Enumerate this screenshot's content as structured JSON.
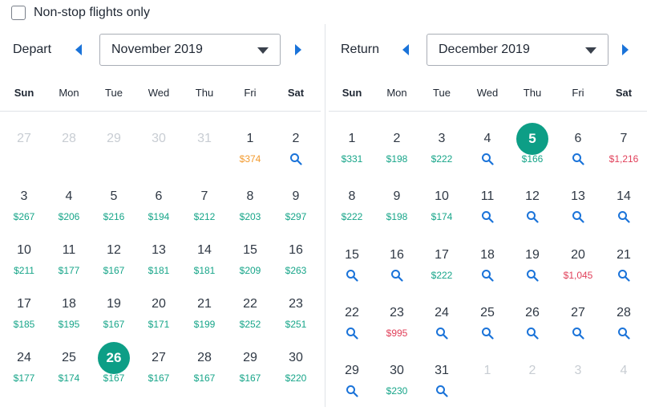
{
  "filters": {
    "nonstop_label": "Non-stop flights only",
    "nonstop_checked": false
  },
  "colors": {
    "accent": "#0d9e86",
    "price_low": "#17a589",
    "price_mid": "#f39b2f",
    "price_high": "#e1405a",
    "arrow": "#1a73d9"
  },
  "weekdays": [
    "Sun",
    "Mon",
    "Tue",
    "Wed",
    "Thu",
    "Fri",
    "Sat"
  ],
  "depart": {
    "label": "Depart",
    "month": "November 2019",
    "rows": [
      [
        {
          "d": "27",
          "m": true
        },
        {
          "d": "28",
          "m": true
        },
        {
          "d": "29",
          "m": true
        },
        {
          "d": "30",
          "m": true
        },
        {
          "d": "31",
          "m": true
        },
        {
          "d": "1",
          "p": "$374",
          "c": "mid"
        },
        {
          "d": "2",
          "s": true
        }
      ],
      [
        {
          "d": "3",
          "p": "$267"
        },
        {
          "d": "4",
          "p": "$206"
        },
        {
          "d": "5",
          "p": "$216"
        },
        {
          "d": "6",
          "p": "$194"
        },
        {
          "d": "7",
          "p": "$212"
        },
        {
          "d": "8",
          "p": "$203"
        },
        {
          "d": "9",
          "p": "$297"
        }
      ],
      [
        {
          "d": "10",
          "p": "$211"
        },
        {
          "d": "11",
          "p": "$177"
        },
        {
          "d": "12",
          "p": "$167"
        },
        {
          "d": "13",
          "p": "$181"
        },
        {
          "d": "14",
          "p": "$181"
        },
        {
          "d": "15",
          "p": "$209"
        },
        {
          "d": "16",
          "p": "$263"
        }
      ],
      [
        {
          "d": "17",
          "p": "$185"
        },
        {
          "d": "18",
          "p": "$195"
        },
        {
          "d": "19",
          "p": "$167"
        },
        {
          "d": "20",
          "p": "$171"
        },
        {
          "d": "21",
          "p": "$199"
        },
        {
          "d": "22",
          "p": "$252"
        },
        {
          "d": "23",
          "p": "$251"
        }
      ],
      [
        {
          "d": "24",
          "p": "$177"
        },
        {
          "d": "25",
          "p": "$174"
        },
        {
          "d": "26",
          "p": "$167",
          "sel": true
        },
        {
          "d": "27",
          "p": "$167"
        },
        {
          "d": "28",
          "p": "$167"
        },
        {
          "d": "29",
          "p": "$167"
        },
        {
          "d": "30",
          "p": "$220"
        }
      ]
    ]
  },
  "ret": {
    "label": "Return",
    "month": "December 2019",
    "rows": [
      [
        {
          "d": "1",
          "p": "$331"
        },
        {
          "d": "2",
          "p": "$198"
        },
        {
          "d": "3",
          "p": "$222"
        },
        {
          "d": "4",
          "s": true
        },
        {
          "d": "5",
          "p": "$166",
          "sel": true
        },
        {
          "d": "6",
          "s": true
        },
        {
          "d": "7",
          "p": "$1,216",
          "c": "high"
        }
      ],
      [
        {
          "d": "8",
          "p": "$222"
        },
        {
          "d": "9",
          "p": "$198"
        },
        {
          "d": "10",
          "p": "$174"
        },
        {
          "d": "11",
          "s": true
        },
        {
          "d": "12",
          "s": true
        },
        {
          "d": "13",
          "s": true
        },
        {
          "d": "14",
          "s": true
        }
      ],
      [
        {
          "d": "15",
          "s": true
        },
        {
          "d": "16",
          "s": true
        },
        {
          "d": "17",
          "p": "$222"
        },
        {
          "d": "18",
          "s": true
        },
        {
          "d": "19",
          "s": true
        },
        {
          "d": "20",
          "p": "$1,045",
          "c": "high"
        },
        {
          "d": "21",
          "s": true
        }
      ],
      [
        {
          "d": "22",
          "s": true
        },
        {
          "d": "23",
          "p": "$995",
          "c": "high"
        },
        {
          "d": "24",
          "s": true
        },
        {
          "d": "25",
          "s": true
        },
        {
          "d": "26",
          "s": true
        },
        {
          "d": "27",
          "s": true
        },
        {
          "d": "28",
          "s": true
        }
      ],
      [
        {
          "d": "29",
          "s": true
        },
        {
          "d": "30",
          "p": "$230"
        },
        {
          "d": "31",
          "s": true
        },
        {
          "d": "1",
          "m": true
        },
        {
          "d": "2",
          "m": true
        },
        {
          "d": "3",
          "m": true
        },
        {
          "d": "4",
          "m": true
        }
      ]
    ]
  }
}
